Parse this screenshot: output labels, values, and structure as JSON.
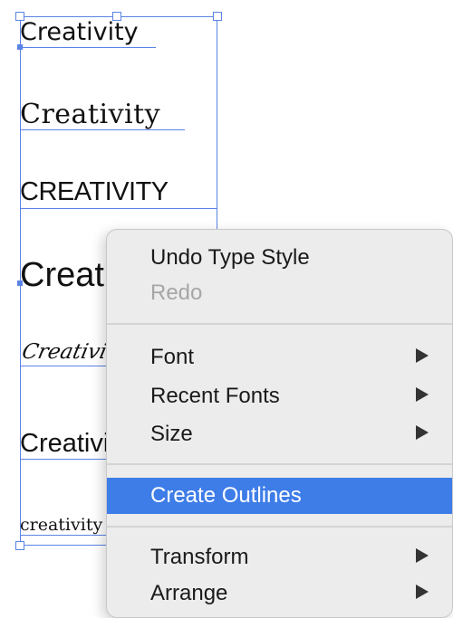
{
  "canvas": {
    "text_samples": [
      "Creativity",
      "Creativity",
      "CREATIVITY",
      "Creativity",
      "Creativity",
      "Creativity",
      "creativity"
    ]
  },
  "context_menu": {
    "undo": "Undo Type Style",
    "redo": "Redo",
    "font": "Font",
    "recent_fonts": "Recent Fonts",
    "size": "Size",
    "create_outlines": "Create Outlines",
    "transform": "Transform",
    "arrange": "Arrange"
  },
  "colors": {
    "selection": "#5a83e6",
    "menu_background": "#ececec",
    "menu_highlight": "#3e7de8"
  },
  "icons": [
    "submenu-arrow-icon"
  ]
}
